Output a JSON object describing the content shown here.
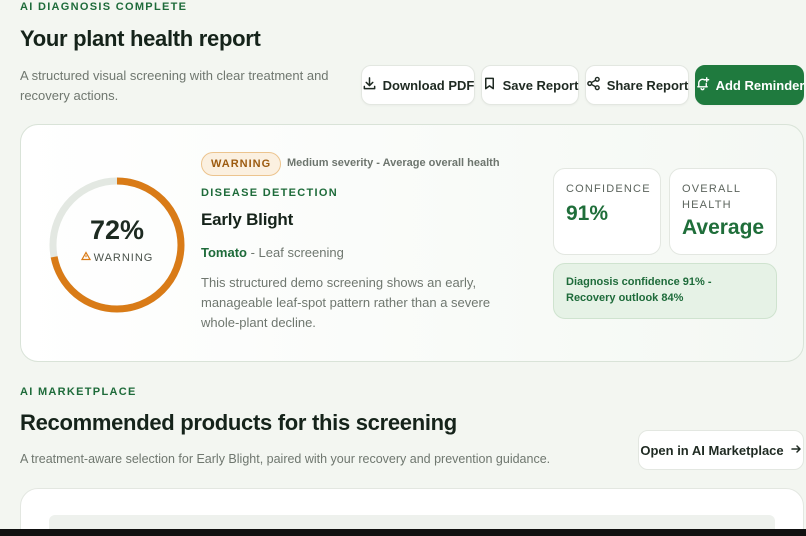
{
  "header": {
    "eyebrow": "AI DIAGNOSIS COMPLETE",
    "title": "Your plant health report",
    "subtitle": "A structured visual screening with clear treatment and recovery actions."
  },
  "actions": {
    "download": {
      "label": "Download PDF",
      "icon": "download-icon"
    },
    "save": {
      "label": "Save Report",
      "icon": "bookmark-icon"
    },
    "share": {
      "label": "Share Report",
      "icon": "share-icon"
    },
    "reminder": {
      "label": "Add Reminder",
      "icon": "bell-plus-icon"
    }
  },
  "diagnosis": {
    "gauge": {
      "value_text": "72%",
      "percent": 72,
      "label": "WARNING",
      "icon": "alert-icon"
    },
    "badge": "WARNING",
    "severity": "Medium severity - Average overall health",
    "section_tag": "DISEASE DETECTION",
    "disease": "Early Blight",
    "crop": "Tomato",
    "scan_type": " - Leaf screening",
    "description": "This structured demo screening shows an early, manageable leaf-spot pattern rather than a severe whole-plant decline.",
    "confidence": {
      "label": "CONFIDENCE",
      "value": "91%"
    },
    "overall_health": {
      "label": "OVERALL HEALTH",
      "value": "Average"
    },
    "outlook": "Diagnosis confidence 91% - Recovery outlook 84%"
  },
  "marketplace": {
    "tag": "AI MARKETPLACE",
    "title": "Recommended products for this screening",
    "subtitle": "A treatment-aware selection for Early Blight, paired with your recovery and prevention guidance.",
    "open_label": "Open in AI Marketplace",
    "open_icon": "arrow-right-icon"
  },
  "colors": {
    "accent": "#1f7a3e",
    "gauge_fill": "#d97b17",
    "gauge_track": "#e3e8e2",
    "warning_bg": "#fbf0e0"
  }
}
